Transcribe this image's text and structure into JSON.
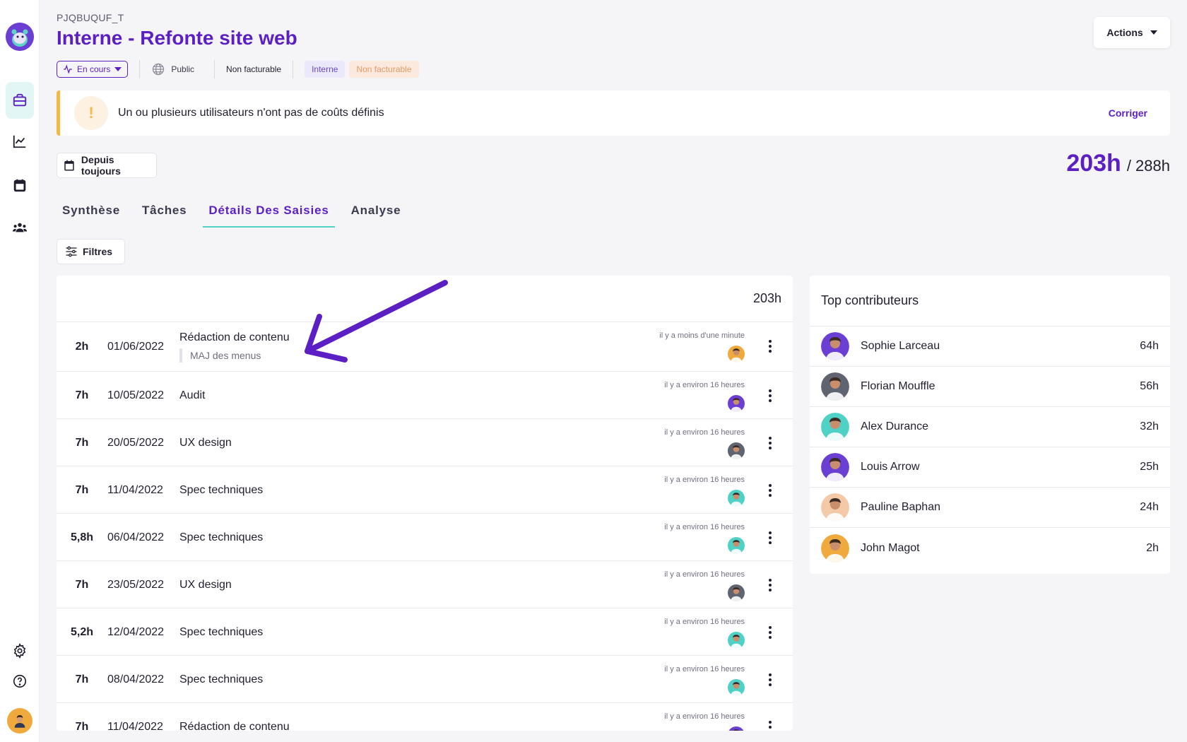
{
  "project": {
    "code": "PJQBUQUF_T",
    "title": "Interne - Refonte site web",
    "status": "En cours",
    "visibility": "Public",
    "billing": "Non facturable",
    "tags": [
      "Interne",
      "Non facturable"
    ],
    "actions_label": "Actions"
  },
  "alert": {
    "icon": "!",
    "message": "Un ou plusieurs utilisateurs n'ont pas de coûts définis",
    "fix_label": "Corriger"
  },
  "period": {
    "label": "Depuis toujours"
  },
  "totals": {
    "spent": "203h",
    "budget": "/ 288h"
  },
  "tabs": [
    "Synthèse",
    "Tâches",
    "Détails Des Saisies",
    "Analyse"
  ],
  "active_tab": "Détails Des Saisies",
  "filters_label": "Filtres",
  "entries": {
    "total": "203h",
    "rows": [
      {
        "duration": "2h",
        "date": "01/06/2022",
        "task": "Rédaction de contenu",
        "note": "MAJ des menus",
        "updated": "il y a moins d'une minute",
        "avatar_color": "#f0a93c"
      },
      {
        "duration": "7h",
        "date": "10/05/2022",
        "task": "Audit",
        "note": "",
        "updated": "il y a environ 16 heures",
        "avatar_color": "#6c3fd4"
      },
      {
        "duration": "7h",
        "date": "20/05/2022",
        "task": "UX design",
        "note": "",
        "updated": "il y a environ 16 heures",
        "avatar_color": "#5f6470"
      },
      {
        "duration": "7h",
        "date": "11/04/2022",
        "task": "Spec techniques",
        "note": "",
        "updated": "il y a environ 16 heures",
        "avatar_color": "#4fd1c5"
      },
      {
        "duration": "5,8h",
        "date": "06/04/2022",
        "task": "Spec techniques",
        "note": "",
        "updated": "il y a environ 16 heures",
        "avatar_color": "#4fd1c5"
      },
      {
        "duration": "7h",
        "date": "23/05/2022",
        "task": "UX design",
        "note": "",
        "updated": "il y a environ 16 heures",
        "avatar_color": "#5f6470"
      },
      {
        "duration": "5,2h",
        "date": "12/04/2022",
        "task": "Spec techniques",
        "note": "",
        "updated": "il y a environ 16 heures",
        "avatar_color": "#4fd1c5"
      },
      {
        "duration": "7h",
        "date": "08/04/2022",
        "task": "Spec techniques",
        "note": "",
        "updated": "il y a environ 16 heures",
        "avatar_color": "#4fd1c5"
      },
      {
        "duration": "7h",
        "date": "11/04/2022",
        "task": "Rédaction de contenu",
        "note": "",
        "updated": "il y a environ 16 heures",
        "avatar_color": "#6c3fd4"
      }
    ]
  },
  "contributors": {
    "title": "Top contributeurs",
    "rows": [
      {
        "name": "Sophie Larceau",
        "hours": "64h",
        "avatar_color": "#6c3fd4"
      },
      {
        "name": "Florian Mouffle",
        "hours": "56h",
        "avatar_color": "#5f6470"
      },
      {
        "name": "Alex Durance",
        "hours": "32h",
        "avatar_color": "#4fd1c5"
      },
      {
        "name": "Louis Arrow",
        "hours": "25h",
        "avatar_color": "#6c3fd4"
      },
      {
        "name": "Pauline Baphan",
        "hours": "24h",
        "avatar_color": "#f4c9a8"
      },
      {
        "name": "John Magot",
        "hours": "2h",
        "avatar_color": "#f0a93c"
      }
    ]
  },
  "colors": {
    "brand": "#5b1fc4",
    "accent": "#4fd1c5",
    "warning": "#f4b942"
  },
  "icons": {
    "sidebar": [
      "briefcase-icon",
      "chart-icon",
      "calendar-icon",
      "team-icon",
      "gear-icon",
      "help-icon"
    ]
  }
}
